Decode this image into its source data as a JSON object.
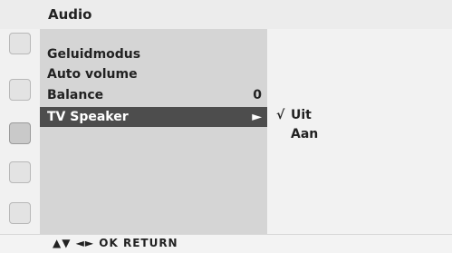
{
  "header": {
    "title": "Audio"
  },
  "sidebar": {
    "items": [
      {
        "icon": "picture-icon"
      },
      {
        "icon": "screen-icon"
      },
      {
        "icon": "audio-icon"
      },
      {
        "icon": "clock-icon"
      },
      {
        "icon": "lock-icon"
      }
    ]
  },
  "menu": {
    "items": [
      {
        "label": "Geluidmodus",
        "value": ""
      },
      {
        "label": "Auto volume",
        "value": ""
      },
      {
        "label": "Balance",
        "value": "0"
      },
      {
        "label": "TV Speaker",
        "value": "►"
      }
    ],
    "selected_index": 3
  },
  "submenu": {
    "items": [
      {
        "label": "Uit",
        "check": "√"
      },
      {
        "label": "Aan",
        "check": ""
      }
    ]
  },
  "footer": {
    "hint": "▲▼ ◄► OK RETURN"
  },
  "colors": {
    "selected_bg": "#4d4d4d",
    "main_bg": "#d5d5d5"
  }
}
